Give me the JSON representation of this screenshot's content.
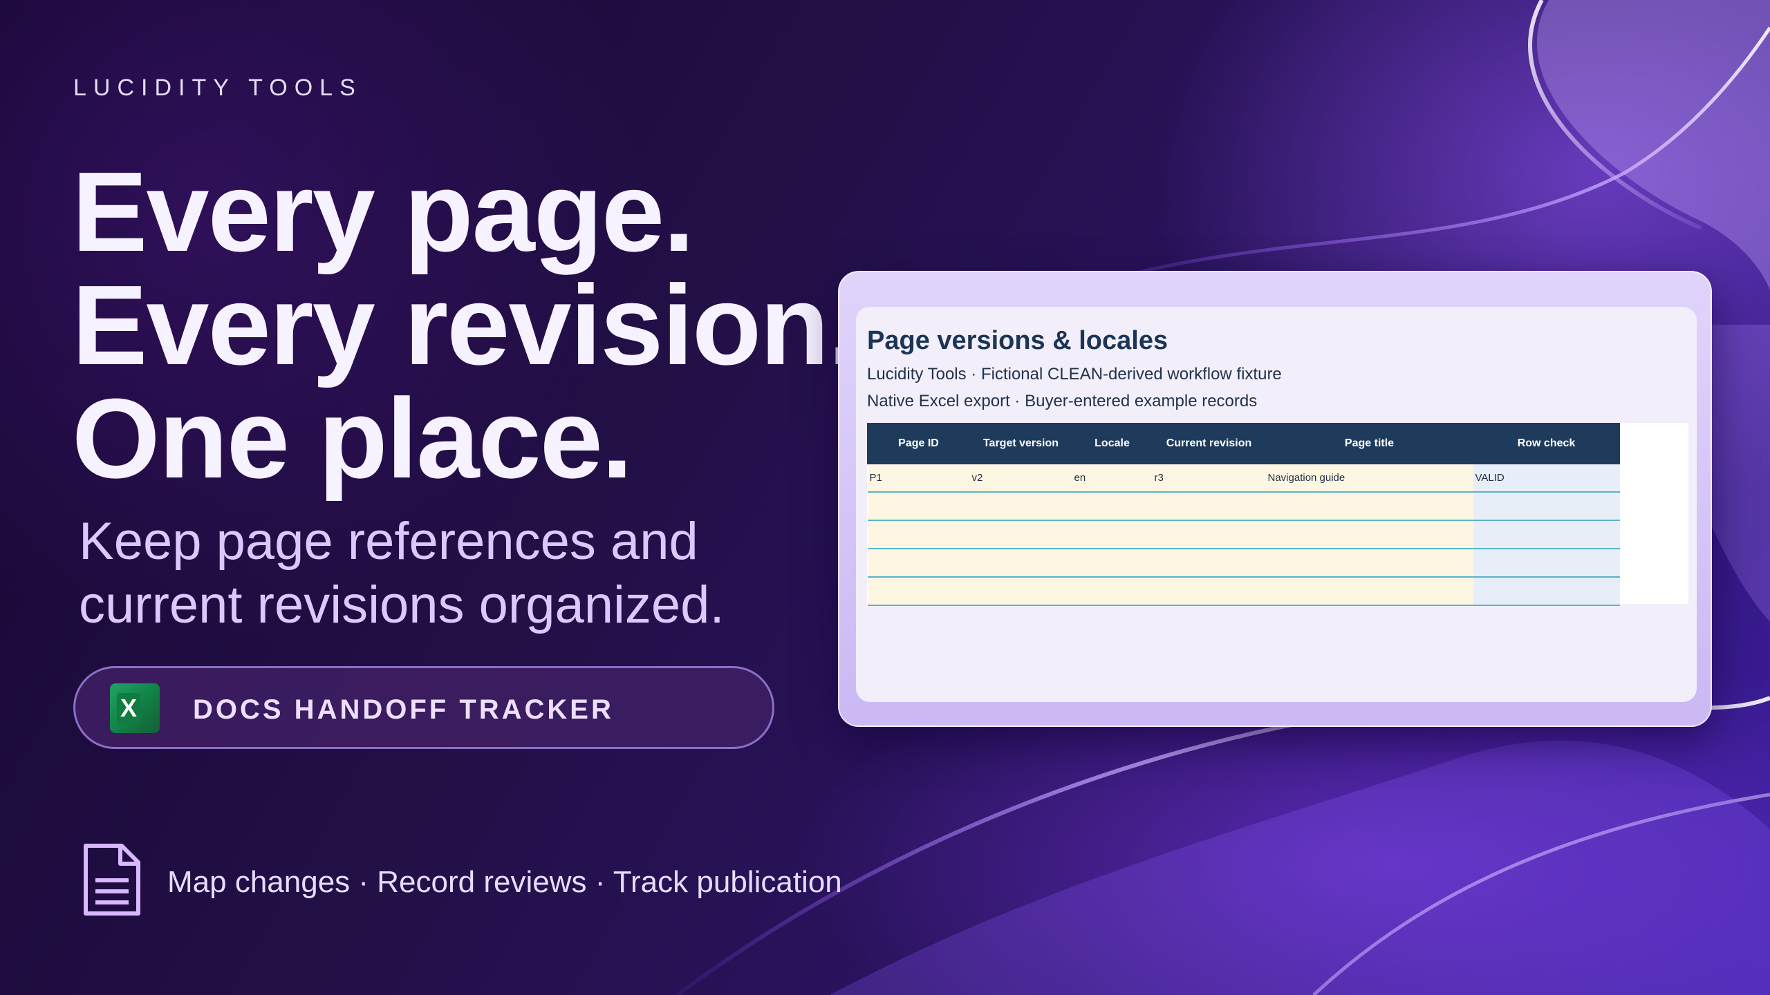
{
  "brand": "LUCIDITY TOOLS",
  "headline": [
    "Every page.",
    "Every revision.",
    "One place."
  ],
  "subhead": "Keep page references and current revisions organized.",
  "product": {
    "icon": "excel-icon",
    "icon_letter": "X",
    "label": "DOCS HANDOFF TRACKER"
  },
  "features": {
    "icon": "document-icon",
    "text": "Map changes · Record reviews · Track publication"
  },
  "sheet": {
    "title": "Page versions & locales",
    "subtitle1": "Lucidity Tools · Fictional CLEAN-derived workflow fixture",
    "subtitle2": "Native Excel export · Buyer-entered example records",
    "columns": [
      "Page ID",
      "Target version",
      "Locale",
      "Current revision",
      "Page title",
      "Row check"
    ],
    "rows": [
      [
        "P1",
        "v2",
        "en",
        "r3",
        "Navigation guide",
        "VALID"
      ],
      [
        "",
        "",
        "",
        "",
        "",
        ""
      ],
      [
        "",
        "",
        "",
        "",
        "",
        ""
      ],
      [
        "",
        "",
        "",
        "",
        "",
        ""
      ],
      [
        "",
        "",
        "",
        "",
        "",
        ""
      ]
    ]
  },
  "colors": {
    "background": "#1c0b3c",
    "accent": "#8b5cf6",
    "table_header": "#1f3b5c",
    "input_cell": "#fdf6e3",
    "check_cell": "#e7eef8",
    "row_border": "#5ab5c9"
  }
}
